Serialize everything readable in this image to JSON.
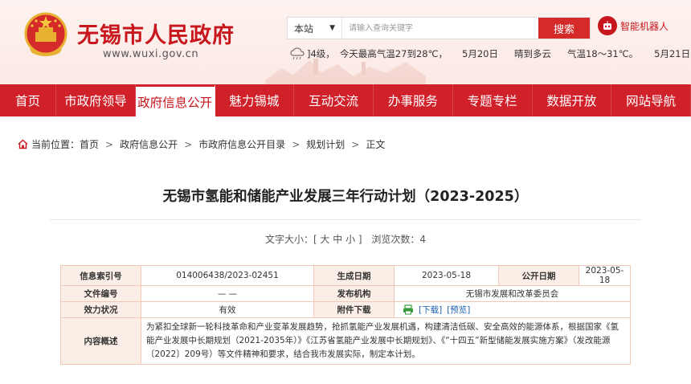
{
  "header": {
    "site_name": "无锡市人民政府",
    "site_url": "www.wuxi.gov.cn",
    "search": {
      "scope": "本站",
      "placeholder": "请输入查询关键字",
      "button": "搜索"
    },
    "robot_label": "智能机器人",
    "weather": {
      "today_wind": "]4级，",
      "today_temp": "今天最高气温27到28℃，",
      "today_date": "5月20日",
      "next_cond": "晴到多云",
      "next_temp": "气温18～31℃。",
      "next_date": "5月21日"
    }
  },
  "nav": {
    "items": [
      {
        "label": "首页"
      },
      {
        "label": "市政府领导"
      },
      {
        "label": "政府信息公开",
        "active": true
      },
      {
        "label": "魅力锡城"
      },
      {
        "label": "互动交流"
      },
      {
        "label": "办事服务"
      },
      {
        "label": "专题专栏"
      },
      {
        "label": "数据开放"
      },
      {
        "label": "网站导航"
      }
    ]
  },
  "breadcrumb": {
    "prefix": "当前位置：",
    "items": [
      "首页",
      "政府信息公开",
      "市政府信息公开目录",
      "规划计划",
      "正文"
    ]
  },
  "article": {
    "title": "无锡市氢能和储能产业发展三年行动计划（2023-2025）",
    "font_size_label": "文字大小：[ 大 中 小 ]",
    "views_label": "浏览次数：",
    "views": "4"
  },
  "info": {
    "index_label": "信息索引号",
    "index_value": "014006438/2023-02451",
    "gen_date_label": "生成日期",
    "gen_date_value": "2023-05-18",
    "pub_date_label": "公开日期",
    "pub_date_value": "2023-05-18",
    "doc_no_label": "文件编号",
    "doc_no_value": "— —",
    "issuer_label": "发布机构",
    "issuer_value": "无锡市发展和改革委员会",
    "validity_label": "效力状况",
    "validity_value": "有效",
    "attachment_label": "附件下载",
    "download_label": "[下载]",
    "preview_label": "[预览]",
    "summary_label": "内容概述",
    "summary_value": "为紧扣全球新一轮科技革命和产业变革发展趋势，抢抓氢能产业发展机遇，构建清洁低碳、安全高效的能源体系，根据国家《氢能产业发展中长期规划（2021-2035年）》《江苏省氢能产业发展中长期规划》、《“十四五”新型储能发展实施方案》（发改能源〔2022〕209号）等文件精神和要求，结合我市发展实际，制定本计划。"
  },
  "colors": {
    "brand_red": "#c8161d",
    "nav_red": "#d0202a",
    "table_border": "#f0c9b8",
    "label_bg": "#fbeee7"
  }
}
